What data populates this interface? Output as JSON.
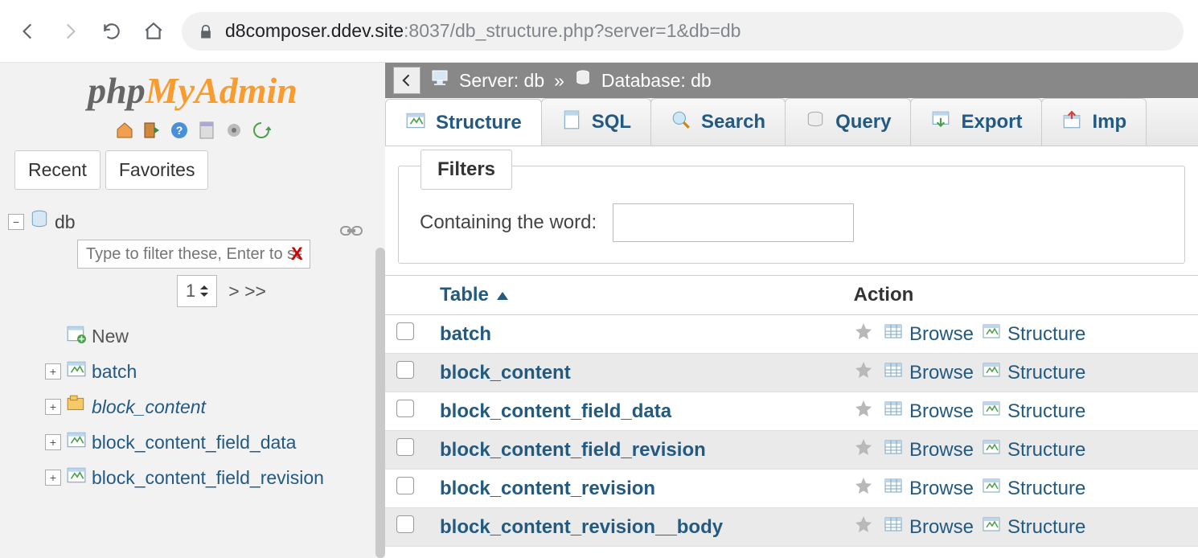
{
  "url": {
    "host": "d8composer.ddev.site",
    "port": ":8037",
    "path": "/db_structure.php?server=1&db=db"
  },
  "logo": {
    "part1": "php",
    "part2": "MyAdmin"
  },
  "sidebar": {
    "recent_label": "Recent",
    "favorites_label": "Favorites",
    "db_name": "db",
    "filter_placeholder": "Type to filter these, Enter to searc",
    "page_current": "1",
    "page_next": "> >>",
    "new_label": "New",
    "tables": [
      {
        "name": "batch",
        "italic": false
      },
      {
        "name": "block_content",
        "italic": true
      },
      {
        "name": "block_content_field_data",
        "italic": false
      },
      {
        "name": "block_content_field_revision",
        "italic": false
      }
    ]
  },
  "breadcrumb": {
    "server_label": "Server: db",
    "sep": "»",
    "db_label": "Database: db"
  },
  "tabs": [
    {
      "label": "Structure",
      "active": true
    },
    {
      "label": "SQL",
      "active": false
    },
    {
      "label": "Search",
      "active": false
    },
    {
      "label": "Query",
      "active": false
    },
    {
      "label": "Export",
      "active": false
    },
    {
      "label": "Imp",
      "active": false
    }
  ],
  "filters": {
    "legend": "Filters",
    "label": "Containing the word:",
    "value": ""
  },
  "table_header": {
    "table": "Table",
    "action": "Action"
  },
  "action_labels": {
    "browse": "Browse",
    "structure": "Structure"
  },
  "rows": [
    {
      "name": "batch"
    },
    {
      "name": "block_content"
    },
    {
      "name": "block_content_field_data"
    },
    {
      "name": "block_content_field_revision"
    },
    {
      "name": "block_content_revision"
    },
    {
      "name": "block_content_revision__body"
    }
  ]
}
